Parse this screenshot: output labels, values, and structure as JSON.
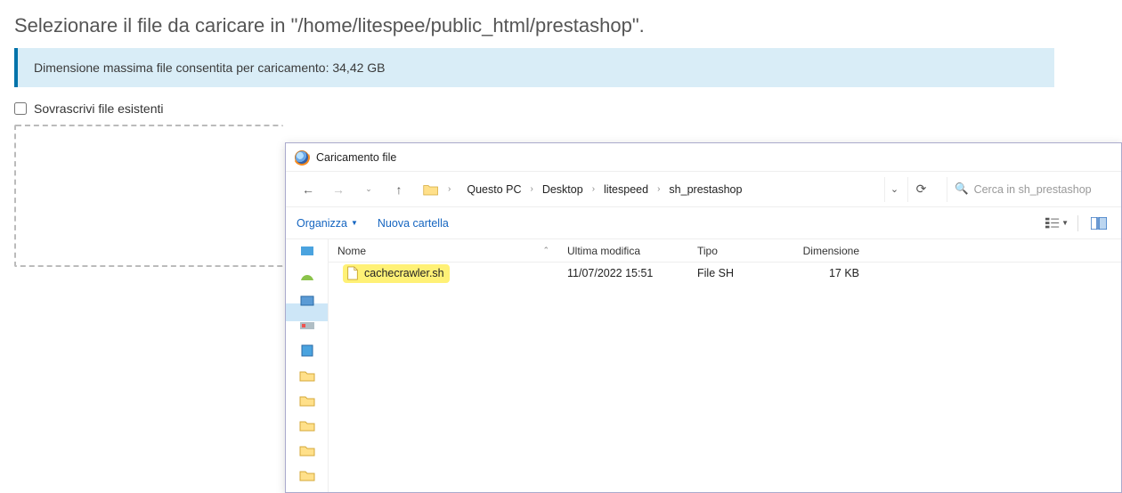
{
  "page": {
    "title": "Selezionare il file da caricare in \"/home/litespee/public_html/prestashop\".",
    "info": "Dimensione massima file consentita per caricamento: 34,42 GB",
    "overwrite_label": "Sovrascrivi file esistenti"
  },
  "dialog": {
    "title": "Caricamento file",
    "breadcrumb": {
      "segments": [
        "Questo PC",
        "Desktop",
        "litespeed",
        "sh_prestashop"
      ]
    },
    "search_placeholder": "Cerca in sh_prestashop",
    "toolbar": {
      "organize": "Organizza",
      "new_folder": "Nuova cartella"
    },
    "columns": {
      "name": "Nome",
      "modified": "Ultima modifica",
      "type": "Tipo",
      "size": "Dimensione"
    },
    "files": [
      {
        "name": "cachecrawler.sh",
        "modified": "11/07/2022 15:51",
        "type": "File SH",
        "size": "17 KB",
        "highlighted": true
      }
    ]
  }
}
